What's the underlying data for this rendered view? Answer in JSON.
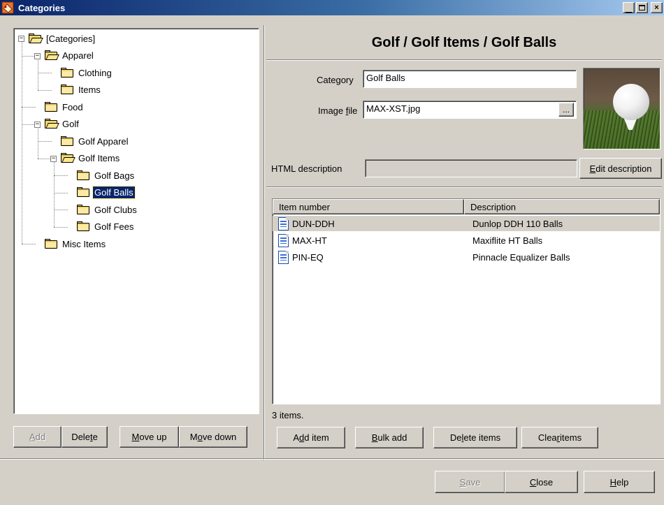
{
  "window": {
    "title": "Categories",
    "buttons": {
      "minimize": "_",
      "maximize": "□",
      "close": "×"
    }
  },
  "tree": {
    "nodes": [
      {
        "label": "[Categories]",
        "icon": "folder-open-icon",
        "expander": "−"
      },
      {
        "label": "Apparel",
        "icon": "folder-open-icon",
        "expander": "−"
      },
      {
        "label": "Clothing",
        "icon": "folder-icon"
      },
      {
        "label": "Items",
        "icon": "folder-icon"
      },
      {
        "label": "Food",
        "icon": "folder-icon"
      },
      {
        "label": "Golf",
        "icon": "folder-open-icon",
        "expander": "−"
      },
      {
        "label": "Golf Apparel",
        "icon": "folder-icon"
      },
      {
        "label": "Golf Items",
        "icon": "folder-open-icon",
        "expander": "−"
      },
      {
        "label": "Golf Bags",
        "icon": "folder-icon"
      },
      {
        "label": "Golf Balls",
        "icon": "folder-icon",
        "selected": true
      },
      {
        "label": "Golf Clubs",
        "icon": "folder-icon"
      },
      {
        "label": "Golf Fees",
        "icon": "folder-icon"
      },
      {
        "label": "Misc Items",
        "icon": "folder-icon"
      }
    ]
  },
  "tree_buttons": {
    "add": {
      "pre": "",
      "key": "A",
      "post": "dd"
    },
    "delete": {
      "pre": "Dele",
      "key": "t",
      "post": "e"
    },
    "move_up": {
      "pre": "",
      "key": "M",
      "post": "ove up"
    },
    "move_down": {
      "pre": "M",
      "key": "o",
      "post": "ve down"
    }
  },
  "header": {
    "path": "Golf / Golf Items / Golf Balls"
  },
  "form": {
    "category_label": {
      "pre": "Cate",
      "key": "g",
      "post": "ory"
    },
    "category_value": "Golf Balls",
    "image_label": {
      "pre": "Image ",
      "key": "f",
      "post": "ile"
    },
    "image_value": "MAX-XST.jpg",
    "browse_label": "...",
    "html_label": "HTML description",
    "html_value": "",
    "edit_desc": {
      "pre": "",
      "key": "E",
      "post": "dit description"
    }
  },
  "items": {
    "columns": [
      "Item number",
      "Description"
    ],
    "rows": [
      {
        "number": "DUN-DDH",
        "description": "Dunlop DDH 110 Balls"
      },
      {
        "number": "MAX-HT",
        "description": "Maxiflite HT Balls"
      },
      {
        "number": "PIN-EQ",
        "description": "Pinnacle Equalizer Balls"
      }
    ],
    "count_text": "3 items."
  },
  "item_buttons": {
    "add_item": {
      "pre": "A",
      "key": "d",
      "post": "d item"
    },
    "bulk_add": {
      "pre": "",
      "key": "B",
      "post": "ulk add"
    },
    "delete_items": {
      "pre": "De",
      "key": "l",
      "post": "ete items"
    },
    "clear_items": {
      "pre": "Clea",
      "key": "r",
      "post": " items"
    }
  },
  "footer_buttons": {
    "save": {
      "pre": "",
      "key": "S",
      "post": "ave"
    },
    "close": {
      "pre": "",
      "key": "C",
      "post": "lose"
    },
    "help": {
      "pre": "",
      "key": "H",
      "post": "elp"
    }
  }
}
